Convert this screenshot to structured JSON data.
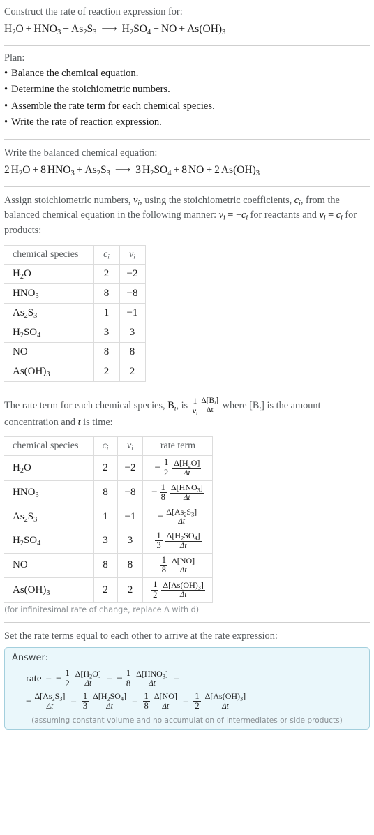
{
  "header": {
    "prompt": "Construct the rate of reaction expression for:",
    "equation": {
      "reactants": [
        {
          "coef": "",
          "formula": [
            {
              "t": "H"
            },
            {
              "t": "2",
              "sub": true
            },
            {
              "t": "O"
            }
          ]
        },
        {
          "coef": "",
          "formula": [
            {
              "t": "HNO"
            },
            {
              "t": "3",
              "sub": true
            }
          ]
        },
        {
          "coef": "",
          "formula": [
            {
              "t": "As"
            },
            {
              "t": "2",
              "sub": true
            },
            {
              "t": "S"
            },
            {
              "t": "3",
              "sub": true
            }
          ]
        }
      ],
      "arrow": "⟶",
      "products": [
        {
          "coef": "",
          "formula": [
            {
              "t": "H"
            },
            {
              "t": "2",
              "sub": true
            },
            {
              "t": "SO"
            },
            {
              "t": "4",
              "sub": true
            }
          ]
        },
        {
          "coef": "",
          "formula": [
            {
              "t": "NO"
            }
          ]
        },
        {
          "coef": "",
          "formula": [
            {
              "t": "As(OH)"
            },
            {
              "t": "3",
              "sub": true
            }
          ]
        }
      ]
    }
  },
  "plan": {
    "label": "Plan:",
    "items": [
      "Balance the chemical equation.",
      "Determine the stoichiometric numbers.",
      "Assemble the rate term for each chemical species.",
      "Write the rate of reaction expression."
    ]
  },
  "balanced": {
    "prompt": "Write the balanced chemical equation:",
    "equation": {
      "reactants": [
        {
          "coef": "2",
          "formula": [
            {
              "t": "H"
            },
            {
              "t": "2",
              "sub": true
            },
            {
              "t": "O"
            }
          ]
        },
        {
          "coef": "8",
          "formula": [
            {
              "t": "HNO"
            },
            {
              "t": "3",
              "sub": true
            }
          ]
        },
        {
          "coef": "",
          "formula": [
            {
              "t": "As"
            },
            {
              "t": "2",
              "sub": true
            },
            {
              "t": "S"
            },
            {
              "t": "3",
              "sub": true
            }
          ]
        }
      ],
      "arrow": "⟶",
      "products": [
        {
          "coef": "3",
          "formula": [
            {
              "t": "H"
            },
            {
              "t": "2",
              "sub": true
            },
            {
              "t": "SO"
            },
            {
              "t": "4",
              "sub": true
            }
          ]
        },
        {
          "coef": "8",
          "formula": [
            {
              "t": "NO"
            }
          ]
        },
        {
          "coef": "2",
          "formula": [
            {
              "t": "As(OH)"
            },
            {
              "t": "3",
              "sub": true
            }
          ]
        }
      ]
    }
  },
  "assign": {
    "text_part1": "Assign stoichiometric numbers, ",
    "nu_i": "ν",
    "text_part2": ", using the stoichiometric coefficients, ",
    "c_i": "c",
    "text_part3": ", from the balanced chemical equation in the following manner: ",
    "rule_reactants": "ν = −c",
    "text_part4": " for reactants and ",
    "rule_products": "ν = c",
    "text_part5": " for products:"
  },
  "table1": {
    "headers": [
      "chemical species",
      "c",
      "ν"
    ],
    "rows": [
      {
        "species": [
          {
            "t": "H"
          },
          {
            "t": "2",
            "sub": true
          },
          {
            "t": "O"
          }
        ],
        "c": "2",
        "v": "−2"
      },
      {
        "species": [
          {
            "t": "HNO"
          },
          {
            "t": "3",
            "sub": true
          }
        ],
        "c": "8",
        "v": "−8"
      },
      {
        "species": [
          {
            "t": "As"
          },
          {
            "t": "2",
            "sub": true
          },
          {
            "t": "S"
          },
          {
            "t": "3",
            "sub": true
          }
        ],
        "c": "1",
        "v": "−1"
      },
      {
        "species": [
          {
            "t": "H"
          },
          {
            "t": "2",
            "sub": true
          },
          {
            "t": "SO"
          },
          {
            "t": "4",
            "sub": true
          }
        ],
        "c": "3",
        "v": "3"
      },
      {
        "species": [
          {
            "t": "NO"
          }
        ],
        "c": "8",
        "v": "8"
      },
      {
        "species": [
          {
            "t": "As(OH)"
          },
          {
            "t": "3",
            "sub": true
          }
        ],
        "c": "2",
        "v": "2"
      }
    ]
  },
  "rateterm_intro": {
    "part1": "The rate term for each chemical species, ",
    "B_i": "B",
    "part2": ", is ",
    "frac_num": "1",
    "frac_den": "ν",
    "delta_num": "Δ[B",
    "delta_den": "Δt",
    "part3": " where [B",
    "part4": "] is the amount concentration and ",
    "t_sym": "t",
    "part5": " is time:"
  },
  "table2": {
    "headers": [
      "chemical species",
      "c",
      "ν",
      "rate term"
    ],
    "rows": [
      {
        "species": [
          {
            "t": "H"
          },
          {
            "t": "2",
            "sub": true
          },
          {
            "t": "O"
          }
        ],
        "c": "2",
        "v": "−2",
        "sign": "−",
        "coef_num": "1",
        "coef_den": "2",
        "delta": [
          {
            "t": "Δ[H"
          },
          {
            "t": "2",
            "sub": true
          },
          {
            "t": "O]"
          }
        ],
        "dt": "Δt"
      },
      {
        "species": [
          {
            "t": "HNO"
          },
          {
            "t": "3",
            "sub": true
          }
        ],
        "c": "8",
        "v": "−8",
        "sign": "−",
        "coef_num": "1",
        "coef_den": "8",
        "delta": [
          {
            "t": "Δ[HNO"
          },
          {
            "t": "3",
            "sub": true
          },
          {
            "t": "]"
          }
        ],
        "dt": "Δt"
      },
      {
        "species": [
          {
            "t": "As"
          },
          {
            "t": "2",
            "sub": true
          },
          {
            "t": "S"
          },
          {
            "t": "3",
            "sub": true
          }
        ],
        "c": "1",
        "v": "−1",
        "sign": "−",
        "coef_num": "",
        "coef_den": "",
        "delta": [
          {
            "t": "Δ[As"
          },
          {
            "t": "2",
            "sub": true
          },
          {
            "t": "S"
          },
          {
            "t": "3",
            "sub": true
          },
          {
            "t": "]"
          }
        ],
        "dt": "Δt"
      },
      {
        "species": [
          {
            "t": "H"
          },
          {
            "t": "2",
            "sub": true
          },
          {
            "t": "SO"
          },
          {
            "t": "4",
            "sub": true
          }
        ],
        "c": "3",
        "v": "3",
        "sign": "",
        "coef_num": "1",
        "coef_den": "3",
        "delta": [
          {
            "t": "Δ[H"
          },
          {
            "t": "2",
            "sub": true
          },
          {
            "t": "SO"
          },
          {
            "t": "4",
            "sub": true
          },
          {
            "t": "]"
          }
        ],
        "dt": "Δt"
      },
      {
        "species": [
          {
            "t": "NO"
          }
        ],
        "c": "8",
        "v": "8",
        "sign": "",
        "coef_num": "1",
        "coef_den": "8",
        "delta": [
          {
            "t": "Δ[NO]"
          }
        ],
        "dt": "Δt"
      },
      {
        "species": [
          {
            "t": "As(OH)"
          },
          {
            "t": "3",
            "sub": true
          }
        ],
        "c": "2",
        "v": "2",
        "sign": "",
        "coef_num": "1",
        "coef_den": "2",
        "delta": [
          {
            "t": "Δ[As(OH)"
          },
          {
            "t": "3",
            "sub": true
          },
          {
            "t": "]"
          }
        ],
        "dt": "Δt"
      }
    ],
    "footnote": "(for infinitesimal rate of change, replace Δ with d)"
  },
  "final": {
    "prompt": "Set the rate terms equal to each other to arrive at the rate expression:",
    "answer_label": "Answer:",
    "rate_label": "rate",
    "equals": "=",
    "terms": [
      {
        "sign": "−",
        "coef_num": "1",
        "coef_den": "2",
        "delta": [
          {
            "t": "Δ[H"
          },
          {
            "t": "2",
            "sub": true
          },
          {
            "t": "O]"
          }
        ],
        "dt": "Δt"
      },
      {
        "sign": "−",
        "coef_num": "1",
        "coef_den": "8",
        "delta": [
          {
            "t": "Δ[HNO"
          },
          {
            "t": "3",
            "sub": true
          },
          {
            "t": "]"
          }
        ],
        "dt": "Δt"
      },
      {
        "sign": "−",
        "coef_num": "",
        "coef_den": "",
        "delta": [
          {
            "t": "Δ[As"
          },
          {
            "t": "2",
            "sub": true
          },
          {
            "t": "S"
          },
          {
            "t": "3",
            "sub": true
          },
          {
            "t": "]"
          }
        ],
        "dt": "Δt"
      },
      {
        "sign": "",
        "coef_num": "1",
        "coef_den": "3",
        "delta": [
          {
            "t": "Δ[H"
          },
          {
            "t": "2",
            "sub": true
          },
          {
            "t": "SO"
          },
          {
            "t": "4",
            "sub": true
          },
          {
            "t": "]"
          }
        ],
        "dt": "Δt"
      },
      {
        "sign": "",
        "coef_num": "1",
        "coef_den": "8",
        "delta": [
          {
            "t": "Δ[NO]"
          }
        ],
        "dt": "Δt"
      },
      {
        "sign": "",
        "coef_num": "1",
        "coef_den": "2",
        "delta": [
          {
            "t": "Δ[As(OH)"
          },
          {
            "t": "3",
            "sub": true
          },
          {
            "t": "]"
          }
        ],
        "dt": "Δt"
      }
    ],
    "assumption": "(assuming constant volume and no accumulation of intermediates or side products)"
  },
  "colors": {
    "answer_border": "#a3cfdd",
    "answer_bg": "#eaf7fb",
    "divider": "#cfcfcf",
    "table_border": "#dcdcdc",
    "muted_text": "#55595c"
  }
}
